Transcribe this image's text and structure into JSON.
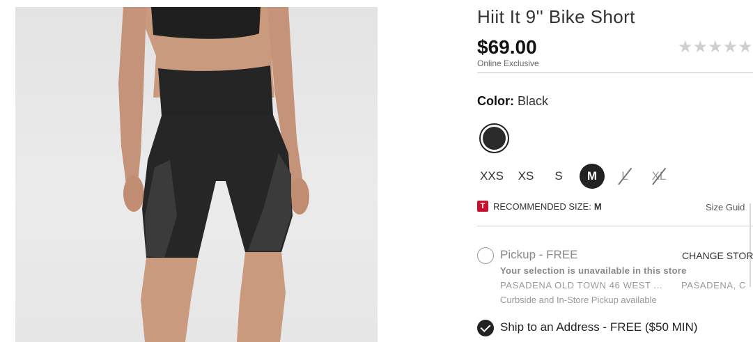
{
  "product": {
    "title": "Hiit It 9'' Bike Short",
    "price": "$69.00",
    "price_note": "Online Exclusive",
    "rating_stars": "★★★★★",
    "image_icon": "product-photo-bike-short"
  },
  "color": {
    "label": "Color:",
    "value": "Black",
    "swatch_hex": "#2a2a2a"
  },
  "sizes": [
    {
      "label": "XXS",
      "state": "available"
    },
    {
      "label": "XS",
      "state": "available"
    },
    {
      "label": "S",
      "state": "available"
    },
    {
      "label": "M",
      "state": "selected"
    },
    {
      "label": "L",
      "state": "unavailable"
    },
    {
      "label": "XL",
      "state": "unavailable"
    }
  ],
  "recommended": {
    "icon_letter": "T",
    "icon_color": "#c8102e",
    "label": "RECOMMENDED SIZE:",
    "value": "M",
    "size_guide": "Size Guid"
  },
  "pickup": {
    "label": "Pickup - FREE",
    "change_store": "CHANGE STOR",
    "unavailable_msg": "Your selection is unavailable in this store",
    "store_name": "PASADENA OLD TOWN 46 WEST ...",
    "store_city": "PASADENA, C",
    "curbside": "Curbside and In-Store Pickup available"
  },
  "shipping": {
    "label": "Ship to an Address - FREE ($50 MIN)"
  }
}
